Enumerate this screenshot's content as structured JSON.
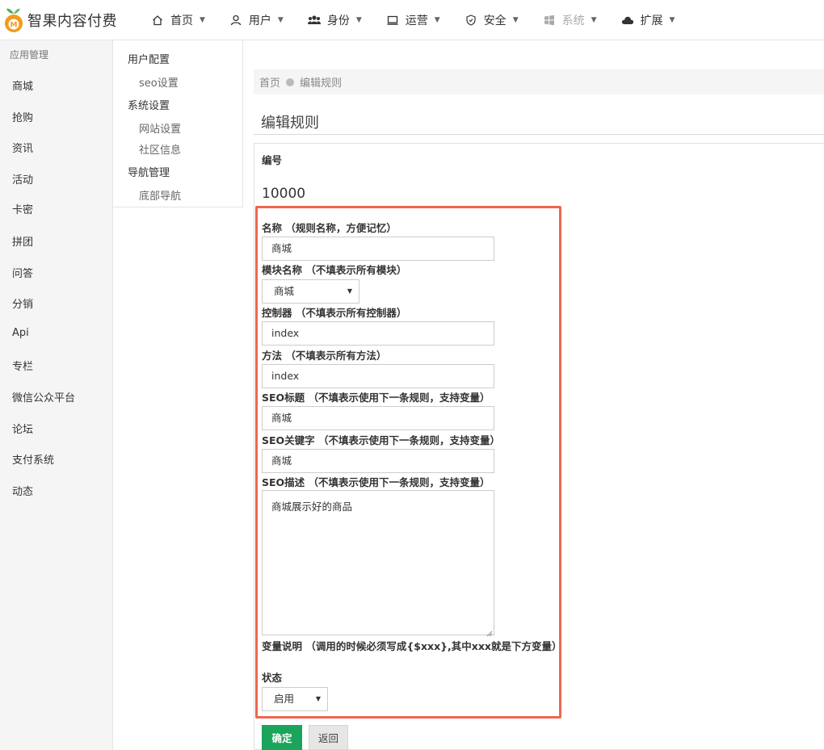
{
  "brand": {
    "name": "智果内容付费",
    "logo_letter": "M"
  },
  "nav": [
    {
      "label": "首页",
      "icon": "home-icon",
      "disabled": false
    },
    {
      "label": "用户",
      "icon": "user-icon",
      "disabled": false
    },
    {
      "label": "身份",
      "icon": "users-icon",
      "disabled": false
    },
    {
      "label": "运营",
      "icon": "monitor-icon",
      "disabled": false
    },
    {
      "label": "安全",
      "icon": "shield-icon",
      "disabled": false
    },
    {
      "label": "系统",
      "icon": "windows-icon",
      "disabled": true
    },
    {
      "label": "扩展",
      "icon": "cloud-icon",
      "disabled": false
    }
  ],
  "sidebar": {
    "title": "应用管理",
    "items": [
      "商城",
      "抢购",
      "资讯",
      "活动",
      "卡密",
      "拼团",
      "问答",
      "分销",
      "Api",
      "专栏",
      "微信公众平台",
      "论坛",
      "支付系统",
      "动态"
    ]
  },
  "submenu": {
    "groups": [
      {
        "label": "用户配置",
        "links": [
          "seo设置"
        ]
      },
      {
        "label": "系统设置",
        "links": [
          "网站设置",
          "社区信息"
        ]
      },
      {
        "label": "导航管理",
        "links": [
          "底部导航"
        ]
      }
    ]
  },
  "breadcrumb": {
    "home": "首页",
    "current": "编辑规则"
  },
  "page_title": "编辑规则",
  "form": {
    "id_label": "编号",
    "id_value": "10000",
    "name_label": "名称",
    "name_hint": "（规则名称，方便记忆）",
    "name_value": "商城",
    "module_label": "模块名称",
    "module_hint": "（不填表示所有模块）",
    "module_value": "商城",
    "controller_label": "控制器",
    "controller_hint": "（不填表示所有控制器）",
    "controller_value": "index",
    "method_label": "方法",
    "method_hint": "（不填表示所有方法）",
    "method_value": "index",
    "seo_title_label": "SEO标题",
    "seo_title_hint": "（不填表示使用下一条规则，支持变量）",
    "seo_title_value": "商城",
    "seo_keywords_label": "SEO关键字",
    "seo_keywords_hint": "（不填表示使用下一条规则，支持变量）",
    "seo_keywords_value": "商城",
    "seo_desc_label": "SEO描述",
    "seo_desc_hint": "（不填表示使用下一条规则，支持变量）",
    "seo_desc_value": "商城展示好的商品",
    "vars_label": "变量说明",
    "vars_hint": "（调用的时候必须写成{$xxx},其中xxx就是下方变量）",
    "status_label": "状态",
    "status_value": "启用"
  },
  "buttons": {
    "ok": "确定",
    "back": "返回"
  },
  "colors": {
    "primary": "#1ba45b",
    "highlight": "#ee6650",
    "logo_orange": "#f39a1e",
    "logo_green": "#4caf50"
  }
}
